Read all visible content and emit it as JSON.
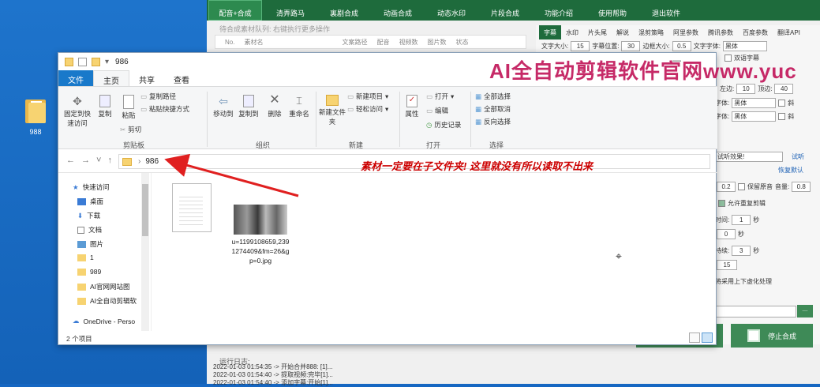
{
  "desktop": {
    "icon_label": "988"
  },
  "app": {
    "toolbar": [
      "配音+合成",
      "清弄路马",
      "裏剧合成",
      "动画合成",
      "动态水印",
      "片段合成",
      "功能介绍",
      "使用帮助",
      "退出软件"
    ],
    "queue_title": "待合成素材队列: 右键执行更多操作",
    "queue_columns": [
      "No.",
      "素材名",
      "文案路径",
      "配音",
      "视频数",
      "图片数",
      "状态"
    ],
    "tabs": [
      "字幕",
      "水印",
      "片头尾",
      "解说",
      "混剪策略",
      "阿里参数",
      "腾讯参数",
      "百度参数",
      "翻译API"
    ],
    "params": {
      "font_size_label": "文字大小:",
      "font_size": "15",
      "sub_pos_label": "字幕位置:",
      "sub_pos": "30",
      "border_label": "边框大小:",
      "border": "0.5",
      "font_label": "文字字体:",
      "font": "黑体",
      "dual_sub": "双语字幕",
      "left_margin_label": "左边:",
      "left_margin": "10",
      "top_margin_label": "顶边:",
      "top_margin": "40",
      "font2_label": "字体:",
      "font2": "黑体",
      "italic": "斜",
      "font3_label": "字体:",
      "font3": "黑体",
      "italic2": "斜",
      "tts_text": "试听效果!",
      "tts_btn": "试听",
      "reset": "恢复默认",
      "speed": "0.2",
      "keep_orig": "保留原音",
      "volume_label": "音量:",
      "volume": "0.8",
      "allow_repeat": "允许重复剪辑",
      "time_label": "时间:",
      "time_val": "1",
      "sec": "秒",
      "start_val": "0",
      "sec2": "秒",
      "duration_label": "持续:",
      "duration_val": "3",
      "sec3": "秒",
      "count_val": "15",
      "blur_note": "将采用上下虚化处理",
      "browse": "..."
    },
    "stop_button": "停止合成",
    "log_title": "运行日志:",
    "log_lines": [
      "2022-01-03 01:54:35 -> 开始合并888: [1]...",
      "2022-01-03 01:54:40 -> 提取视频:完毕[1]...",
      "2022-01-03 01:54:40 -> 添加字幕:开始[1]..."
    ],
    "watermark": "AI全自动剪辑软件官网www.yuc"
  },
  "explorer": {
    "title": "986",
    "menu": [
      "文件",
      "主页",
      "共享",
      "查看"
    ],
    "ribbon": {
      "pin": "固定到快速访问",
      "copy": "复制",
      "paste": "粘贴",
      "copy_path": "复制路径",
      "paste_shortcut": "粘贴快捷方式",
      "cut": "剪切",
      "move_to": "移动到",
      "copy_to": "复制到",
      "delete": "删除",
      "rename": "重命名",
      "new_folder": "新建文件夹",
      "new_item": "新建项目",
      "easy_access": "轻松访问",
      "properties": "属性",
      "open": "打开",
      "edit": "编辑",
      "history": "历史记录",
      "select_all": "全部选择",
      "select_none": "全部取消",
      "invert": "反向选择",
      "groups": [
        "剪贴板",
        "组织",
        "新建",
        "打开",
        "选择"
      ]
    },
    "address": {
      "path": "986"
    },
    "annotation": "素材一定要在子文件夹! 这里就没有所以读取不出来",
    "annotation_color": "#cc0000",
    "nav": [
      "快速访问",
      "桌面",
      "下载",
      "文档",
      "图片",
      "1",
      "989",
      "AI官网网站图",
      "AI全自动剪辑软",
      "OneDrive - Perso"
    ],
    "file_name": "u=1199108659,2391274409&fm=26&gp=0.jpg",
    "status": "2 个项目"
  }
}
